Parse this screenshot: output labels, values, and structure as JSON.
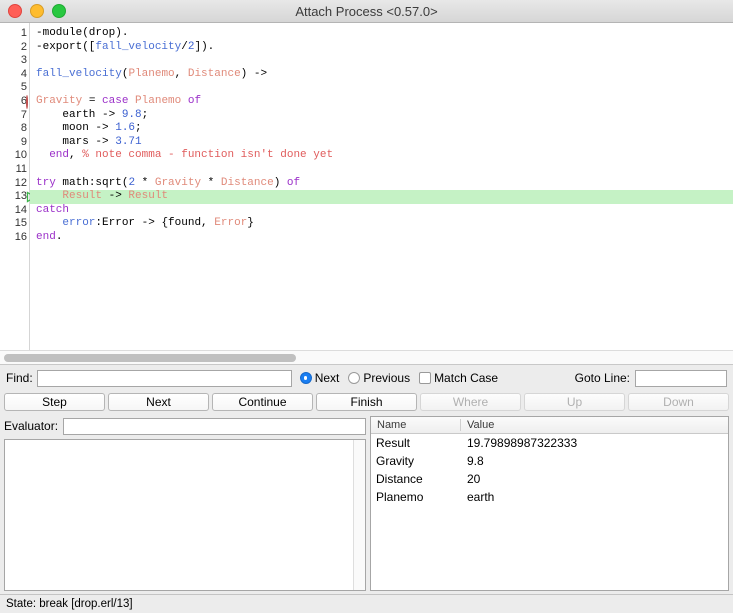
{
  "window": {
    "title": "Attach Process <0.57.0>",
    "controls": [
      {
        "name": "close",
        "color": "#ff5f57"
      },
      {
        "name": "minimize",
        "color": "#febc2e"
      },
      {
        "name": "zoom",
        "color": "#28c840"
      }
    ]
  },
  "editor": {
    "breakpoint_line": 6,
    "current_line": 13,
    "lines": [
      {
        "n": "1",
        "tokens": [
          {
            "t": "-module(drop).",
            "c": "plain"
          }
        ]
      },
      {
        "n": "2",
        "tokens": [
          {
            "t": "-export([",
            "c": "plain"
          },
          {
            "t": "fall_velocity",
            "c": "fn"
          },
          {
            "t": "/",
            "c": "plain"
          },
          {
            "t": "2",
            "c": "num"
          },
          {
            "t": "]).",
            "c": "plain"
          }
        ]
      },
      {
        "n": "3",
        "tokens": []
      },
      {
        "n": "4",
        "tokens": [
          {
            "t": "fall_velocity",
            "c": "fn"
          },
          {
            "t": "(",
            "c": "plain"
          },
          {
            "t": "Planemo",
            "c": "var"
          },
          {
            "t": ", ",
            "c": "plain"
          },
          {
            "t": "Distance",
            "c": "var"
          },
          {
            "t": ") ->",
            "c": "plain"
          }
        ]
      },
      {
        "n": "5",
        "tokens": []
      },
      {
        "n": "6",
        "tokens": [
          {
            "t": "Gravity",
            "c": "var"
          },
          {
            "t": " = ",
            "c": "plain"
          },
          {
            "t": "case",
            "c": "kw"
          },
          {
            "t": " ",
            "c": "plain"
          },
          {
            "t": "Planemo",
            "c": "var"
          },
          {
            "t": " ",
            "c": "plain"
          },
          {
            "t": "of",
            "c": "kw"
          }
        ]
      },
      {
        "n": "7",
        "tokens": [
          {
            "t": "    earth -> ",
            "c": "plain"
          },
          {
            "t": "9.8",
            "c": "num"
          },
          {
            "t": ";",
            "c": "plain"
          }
        ]
      },
      {
        "n": "8",
        "tokens": [
          {
            "t": "    moon -> ",
            "c": "plain"
          },
          {
            "t": "1.6",
            "c": "num"
          },
          {
            "t": ";",
            "c": "plain"
          }
        ]
      },
      {
        "n": "9",
        "tokens": [
          {
            "t": "    mars -> ",
            "c": "plain"
          },
          {
            "t": "3.71",
            "c": "num"
          }
        ]
      },
      {
        "n": "10",
        "tokens": [
          {
            "t": "  ",
            "c": "plain"
          },
          {
            "t": "end",
            "c": "kw"
          },
          {
            "t": ", ",
            "c": "plain"
          },
          {
            "t": "% note comma - function isn't done yet",
            "c": "com"
          }
        ]
      },
      {
        "n": "11",
        "tokens": []
      },
      {
        "n": "12",
        "tokens": [
          {
            "t": "try",
            "c": "kw"
          },
          {
            "t": " math:sqrt(",
            "c": "plain"
          },
          {
            "t": "2",
            "c": "num"
          },
          {
            "t": " * ",
            "c": "plain"
          },
          {
            "t": "Gravity",
            "c": "var"
          },
          {
            "t": " * ",
            "c": "plain"
          },
          {
            "t": "Distance",
            "c": "var"
          },
          {
            "t": ") ",
            "c": "plain"
          },
          {
            "t": "of",
            "c": "kw"
          }
        ]
      },
      {
        "n": "13",
        "tokens": [
          {
            "t": "    ",
            "c": "plain"
          },
          {
            "t": "Result",
            "c": "var"
          },
          {
            "t": " -> ",
            "c": "plain"
          },
          {
            "t": "Result",
            "c": "var"
          }
        ]
      },
      {
        "n": "14",
        "tokens": [
          {
            "t": "catch",
            "c": "kw"
          }
        ]
      },
      {
        "n": "15",
        "tokens": [
          {
            "t": "    ",
            "c": "plain"
          },
          {
            "t": "error",
            "c": "fn"
          },
          {
            "t": ":",
            "c": "plain"
          },
          {
            "t": "Error",
            "c": "plain"
          },
          {
            "t": " -> {found, ",
            "c": "plain"
          },
          {
            "t": "Error",
            "c": "var"
          },
          {
            "t": "}",
            "c": "plain"
          }
        ]
      },
      {
        "n": "16",
        "tokens": [
          {
            "t": "end",
            "c": "kw"
          },
          {
            "t": ".",
            "c": "plain"
          }
        ]
      }
    ]
  },
  "find": {
    "label": "Find:",
    "value": "",
    "placeholder": "",
    "next_label": "Next",
    "previous_label": "Previous",
    "match_case_label": "Match Case",
    "direction_selected": "Next",
    "match_case_checked": false,
    "goto_line_label": "Goto Line:",
    "goto_line_value": "",
    "goto_line_placeholder": ""
  },
  "buttons": [
    {
      "label": "Step",
      "enabled": true
    },
    {
      "label": "Next",
      "enabled": true
    },
    {
      "label": "Continue",
      "enabled": true
    },
    {
      "label": "Finish",
      "enabled": true
    },
    {
      "label": "Where",
      "enabled": false
    },
    {
      "label": "Up",
      "enabled": false
    },
    {
      "label": "Down",
      "enabled": false
    }
  ],
  "evaluator": {
    "label": "Evaluator:",
    "value": "",
    "placeholder": "",
    "output": ""
  },
  "variables": {
    "columns": [
      "Name",
      "Value"
    ],
    "rows": [
      {
        "name": "Result",
        "value": "19.79898987322333"
      },
      {
        "name": "Gravity",
        "value": "9.8"
      },
      {
        "name": "Distance",
        "value": "20"
      },
      {
        "name": "Planemo",
        "value": "earth"
      }
    ]
  },
  "status": {
    "text": "State: break [drop.erl/13]"
  }
}
